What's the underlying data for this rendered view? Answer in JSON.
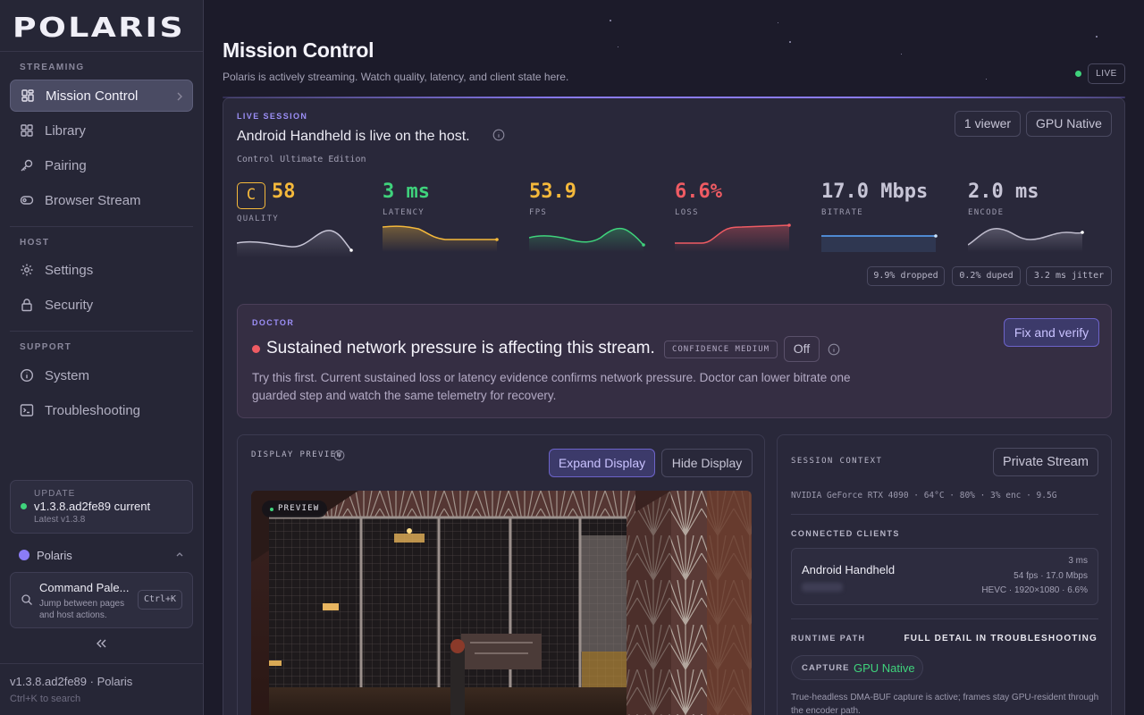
{
  "app": {
    "logo_text": "POLARIS"
  },
  "sidebar": {
    "sections": {
      "streaming": "STREAMING",
      "host": "HOST",
      "support": "SUPPORT"
    },
    "items": {
      "mission_control": {
        "label": "Mission Control",
        "icon": "dashboard-icon"
      },
      "library": {
        "label": "Library",
        "icon": "grid-icon"
      },
      "pairing": {
        "label": "Pairing",
        "icon": "key-icon"
      },
      "browser_stream": {
        "label": "Browser Stream",
        "icon": "stream-icon"
      },
      "settings": {
        "label": "Settings",
        "icon": "gear-icon"
      },
      "security": {
        "label": "Security",
        "icon": "lock-icon"
      },
      "system": {
        "label": "System",
        "icon": "info-icon"
      },
      "troubleshooting": {
        "label": "Troubleshooting",
        "icon": "terminal-icon"
      }
    },
    "update": {
      "label": "UPDATE",
      "version": "v1.3.8.ad2fe89 current",
      "latest": "Latest v1.3.8"
    },
    "brand": "Polaris",
    "command_palette": {
      "title": "Command Pale...",
      "description": "Jump between pages and host actions.",
      "shortcut": "Ctrl+K"
    },
    "footer": {
      "version": "v1.3.8.ad2fe89 · Polaris",
      "hint": "Ctrl+K to search"
    }
  },
  "header": {
    "title": "Mission Control",
    "subtitle": "Polaris is actively streaming. Watch quality, latency, and client state here.",
    "live_badge": "LIVE"
  },
  "session": {
    "tag": "LIVE SESSION",
    "title": "Android Handheld is live on the host.",
    "subtitle": "Control Ultimate Edition",
    "viewers": "1 viewer",
    "encoder": "GPU Native",
    "metrics": {
      "quality": {
        "grade": "C",
        "value": "58",
        "label": "QUALITY"
      },
      "latency": {
        "value": "3 ms",
        "label": "LATENCY"
      },
      "fps": {
        "value": "53.9",
        "label": "FPS"
      },
      "loss": {
        "value": "6.6%",
        "label": "LOSS"
      },
      "bitrate": {
        "value": "17.0 Mbps",
        "label": "BITRATE"
      },
      "encode": {
        "value": "2.0 ms",
        "label": "ENCODE"
      }
    },
    "stats": {
      "dropped": "9.9% dropped",
      "duped": "0.2% duped",
      "jitter": "3.2 ms jitter"
    }
  },
  "doctor": {
    "tag": "DOCTOR",
    "title": "Sustained network pressure is affecting this stream.",
    "confidence": "CONFIDENCE MEDIUM",
    "toggle": "Off",
    "action": "Fix and verify",
    "body": "Try this first. Current sustained loss or latency evidence confirms network pressure. Doctor can lower bitrate one guarded step and watch the same telemetry for recovery."
  },
  "preview": {
    "tag": "DISPLAY PREVIEW",
    "expand": "Expand Display",
    "hide": "Hide Display",
    "badge": "PREVIEW"
  },
  "context": {
    "tag": "SESSION CONTEXT",
    "mode": "Private Stream",
    "hardware": "NVIDIA GeForce RTX 4090 · 64°C · 80% · 3% enc · 9.5G",
    "clients_label": "CONNECTED CLIENTS",
    "client": {
      "name": "Android Handheld",
      "latency": "3 ms",
      "rate": "54 fps · 17.0 Mbps",
      "codec": "HEVC · 1920×1080 · 6.6%"
    },
    "runtime_label": "RUNTIME PATH",
    "runtime_link": "FULL DETAIL IN TROUBLESHOOTING",
    "capture_label": "CAPTURE",
    "capture_value": "GPU Native",
    "capture_desc": "True-headless DMA-BUF capture is active; frames stay GPU-resident through the encoder path."
  },
  "colors": {
    "accent": "#8b7cf6",
    "quality": "#f5b93b",
    "latency": "#3fd37c",
    "fps": "#f5b93b",
    "loss": "#ef5b63",
    "bitrate": "#8d8ba3",
    "encode": "#8d8ba3",
    "live": "#3fd37c"
  }
}
